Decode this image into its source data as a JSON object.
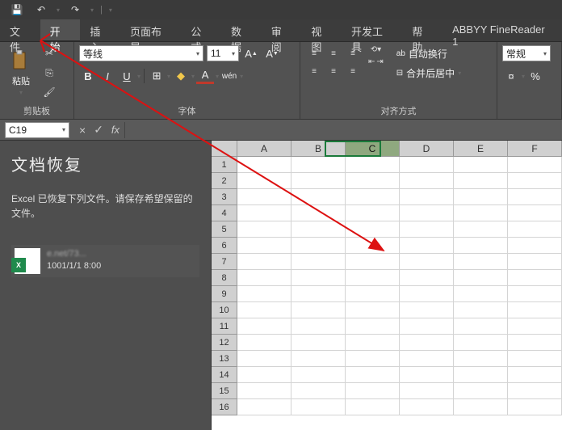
{
  "qat": {
    "save": "💾",
    "undo": "↶",
    "redo": "↷",
    "more": "▾"
  },
  "tabs": [
    "文件",
    "开始",
    "插入",
    "页面布局",
    "公式",
    "数据",
    "审阅",
    "视图",
    "开发工具",
    "帮助",
    "ABBYY FineReader 1"
  ],
  "activeTab": 1,
  "ribbon": {
    "clipboard": {
      "label": "剪贴板",
      "paste": "粘贴",
      "cut": "✂",
      "copy": "⎘",
      "painter": "🖌"
    },
    "font": {
      "label": "字体",
      "name": "等线",
      "size": "11",
      "grow": "A",
      "shrink": "A",
      "bold": "B",
      "italic": "I",
      "underline": "U",
      "border": "⊞",
      "fill": "◆",
      "color": "A",
      "phonetic": "wén"
    },
    "align": {
      "label": "对齐方式",
      "wrap": "自动换行",
      "merge": "合并后居中"
    },
    "number": {
      "label": "常规",
      "currency": "¤",
      "percent": "%"
    }
  },
  "namebox": "C19",
  "fxbuttons": {
    "cancel": "×",
    "ok": "✓",
    "fx": "fx"
  },
  "recovery": {
    "title": "文档恢复",
    "msg": "Excel 已恢复下列文件。请保存希望保留的文件。",
    "doc": {
      "line1": "e.net/73...",
      "line2": " ",
      "ts": "1001/1/1 8:00"
    }
  },
  "columns": [
    "A",
    "B",
    "C",
    "D",
    "E",
    "F"
  ],
  "rows": [
    1,
    2,
    3,
    4,
    5,
    6,
    7,
    8,
    9,
    10,
    11,
    12,
    13,
    14,
    15,
    16
  ],
  "selectedCol": 2
}
